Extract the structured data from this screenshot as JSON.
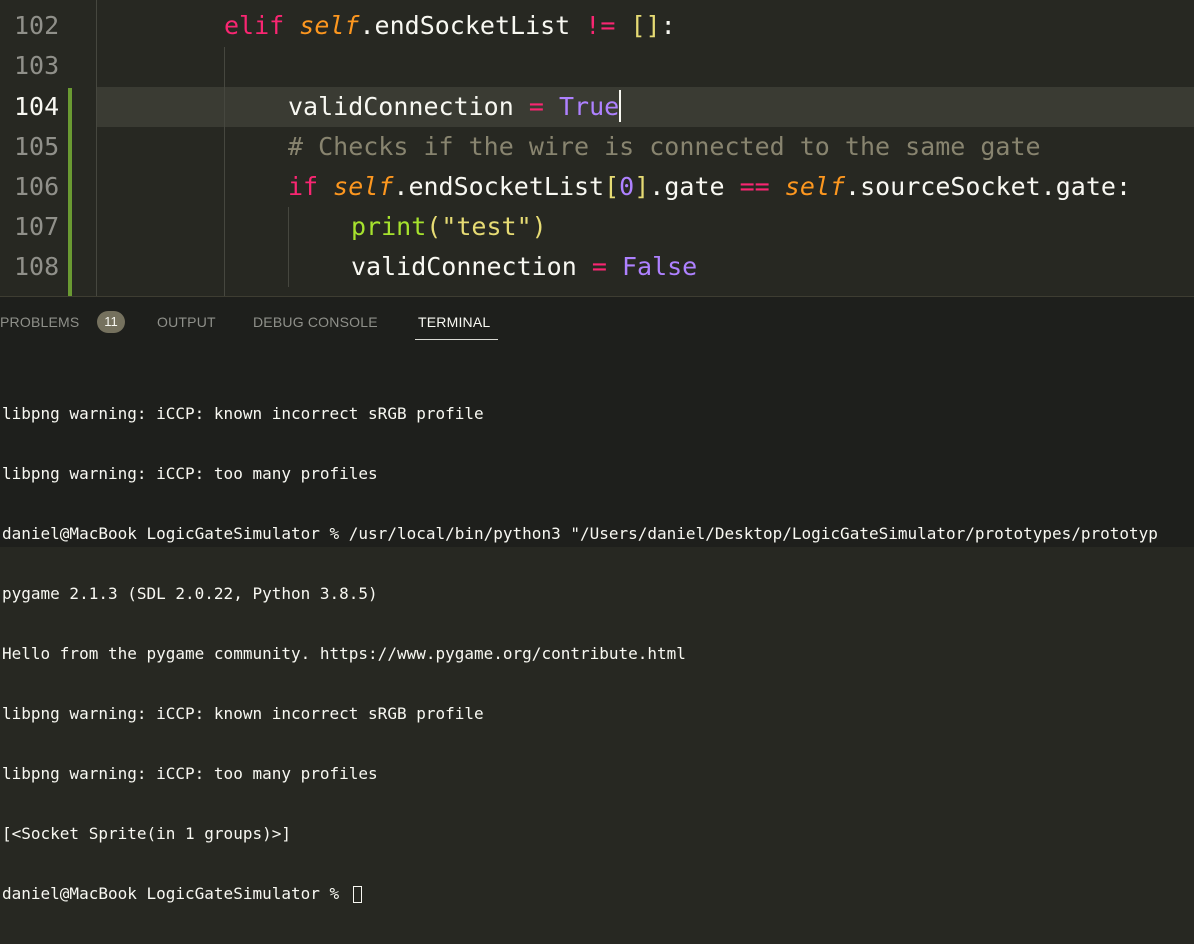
{
  "editor": {
    "lines": [
      {
        "num": "102"
      },
      {
        "num": "103"
      },
      {
        "num": "104"
      },
      {
        "num": "105"
      },
      {
        "num": "106"
      },
      {
        "num": "107"
      },
      {
        "num": "108"
      }
    ],
    "code": {
      "l102": {
        "kw": "elif",
        "self": "self",
        "attr": ".endSocketList",
        "op": "!=",
        "bracket": "[]",
        "colon": ":"
      },
      "l104": {
        "name": "validConnection",
        "op": "=",
        "const": "True"
      },
      "l105": {
        "comment": "# Checks if the wire is connected to the same gate"
      },
      "l106": {
        "kw": "if",
        "self1": "self",
        "attr1": ".endSocketList",
        "b_open": "[",
        "num": "0",
        "b_close": "]",
        "attr2": ".gate",
        "op": "==",
        "self2": "self",
        "attr3": ".sourceSocket.gate:"
      },
      "l107": {
        "fn": "print",
        "p_open": "(",
        "str": "\"test\"",
        "p_close": ")"
      },
      "l108": {
        "name": "validConnection",
        "op": "=",
        "const": "False"
      }
    },
    "colors": {
      "background": "#272822",
      "keyword": "#f92672",
      "self": "#fd971f",
      "function": "#a6e22e",
      "string": "#e6db74",
      "constant": "#ae81ff",
      "comment": "#88846f"
    }
  },
  "panel": {
    "tabs": [
      {
        "label": "PROBLEMS",
        "badge": "11"
      },
      {
        "label": "OUTPUT"
      },
      {
        "label": "DEBUG CONSOLE"
      },
      {
        "label": "TERMINAL",
        "active": true
      }
    ],
    "terminal": {
      "lines": [
        "libpng warning: iCCP: known incorrect sRGB profile",
        "libpng warning: iCCP: too many profiles",
        "daniel@MacBook LogicGateSimulator % /usr/local/bin/python3 \"/Users/daniel/Desktop/LogicGateSimulator/prototypes/prototyp",
        "pygame 2.1.3 (SDL 2.0.22, Python 3.8.5)",
        "Hello from the pygame community. https://www.pygame.org/contribute.html",
        "libpng warning: iCCP: known incorrect sRGB profile",
        "libpng warning: iCCP: too many profiles",
        "[<Socket Sprite(in 1 groups)>]"
      ],
      "prompt": "daniel@MacBook LogicGateSimulator % "
    }
  }
}
